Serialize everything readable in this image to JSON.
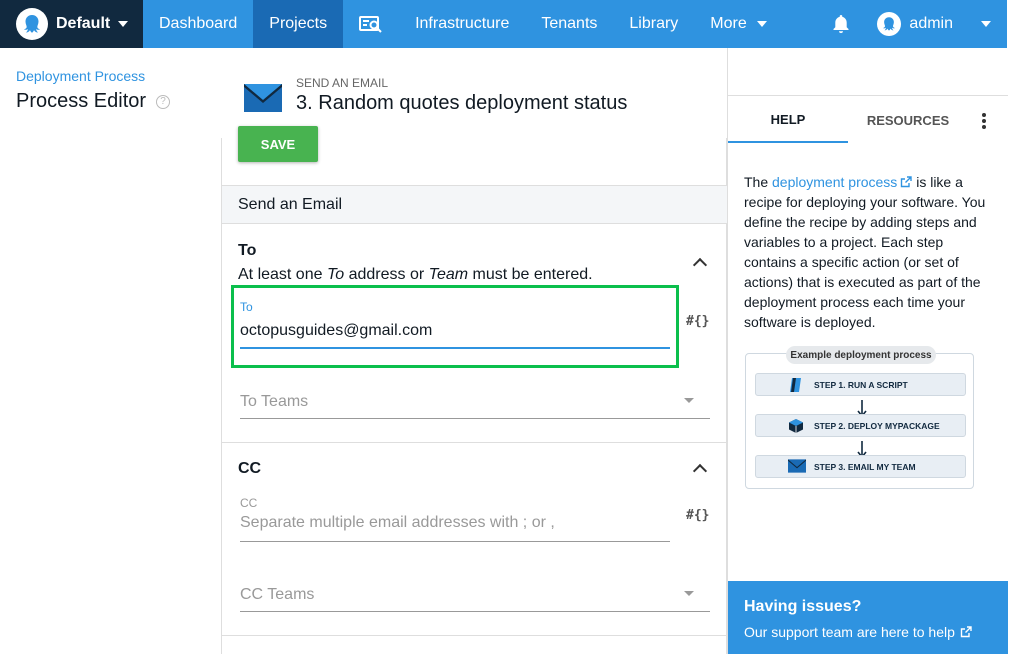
{
  "nav": {
    "space": "Default",
    "links": [
      "Dashboard",
      "Projects",
      "Infrastructure",
      "Tenants",
      "Library",
      "More"
    ],
    "active": "Projects",
    "user": "admin",
    "accent": "#2f93e0",
    "space_bg": "#11293f"
  },
  "page": {
    "breadcrumb": "Deployment Process",
    "title": "Process Editor"
  },
  "step": {
    "kind": "SEND AN EMAIL",
    "number": "3.",
    "title": "Random quotes deployment status"
  },
  "save_label": "SAVE",
  "form": {
    "header": "Send an Email",
    "to": {
      "title": "To",
      "desc_1": "At least one ",
      "desc_em1": "To",
      "desc_2": " address or ",
      "desc_em2": "Team",
      "desc_3": " must be entered.",
      "field_label": "To",
      "field_value": "octopusguides@gmail.com",
      "teams_placeholder": "To Teams",
      "var_icon": "#{}"
    },
    "cc": {
      "title": "CC",
      "field_label": "CC",
      "field_placeholder": "Separate multiple email addresses with ; or ,",
      "teams_placeholder": "CC Teams",
      "var_icon": "#{}"
    }
  },
  "help_panel": {
    "tabs": [
      "HELP",
      "RESOURCES"
    ],
    "active_tab": "HELP",
    "text_before": "The ",
    "link": "deployment process",
    "text_after": " is like a recipe for deploying your software. You define the recipe by adding steps and variables to a project. Each step contains a specific action (or set of actions) that is executed as part of the deployment process each time your software is deployed.",
    "example": {
      "title": "Example deployment process",
      "steps": [
        "STEP 1. RUN A SCRIPT",
        "STEP 2. DEPLOY MYPACKAGE",
        "STEP 3. EMAIL MY TEAM"
      ]
    },
    "issues_title": "Having issues?",
    "issues_link": "Our support team are here to help"
  },
  "colors": {
    "save_green": "#48b350",
    "highlight": "#0bbf4c",
    "focus_blue": "#2f93e0"
  }
}
